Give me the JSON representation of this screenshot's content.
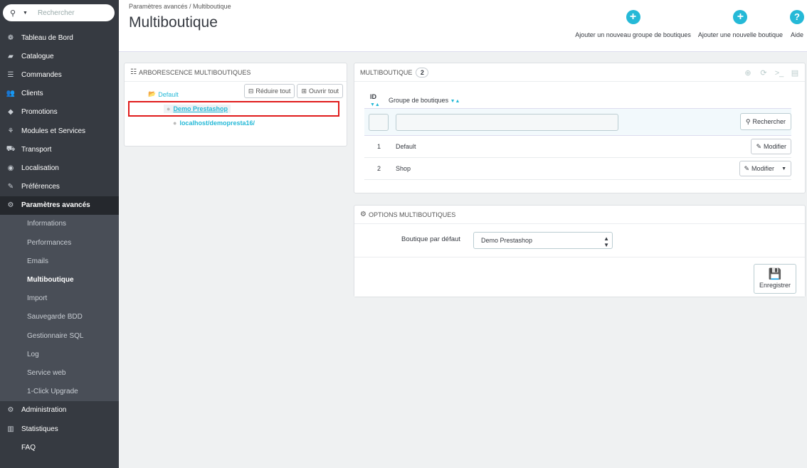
{
  "sidebar": {
    "search_placeholder": "Rechercher",
    "items": [
      {
        "label": "Tableau de Bord",
        "icon": "dashboard-icon",
        "glyph": "❁"
      },
      {
        "label": "Catalogue",
        "icon": "catalog-icon",
        "glyph": "▰"
      },
      {
        "label": "Commandes",
        "icon": "orders-icon",
        "glyph": "☰"
      },
      {
        "label": "Clients",
        "icon": "customers-icon",
        "glyph": "👥"
      },
      {
        "label": "Promotions",
        "icon": "promotions-icon",
        "glyph": "◆"
      },
      {
        "label": "Modules et Services",
        "icon": "modules-icon",
        "glyph": "⚘"
      },
      {
        "label": "Transport",
        "icon": "transport-icon",
        "glyph": "⛟"
      },
      {
        "label": "Localisation",
        "icon": "localisation-icon",
        "glyph": "◉"
      },
      {
        "label": "Préférences",
        "icon": "preferences-icon",
        "glyph": "✎"
      },
      {
        "label": "Paramètres avancés",
        "icon": "advanced-settings-icon",
        "glyph": "⚙"
      }
    ],
    "subitems": [
      "Informations",
      "Performances",
      "Emails",
      "Multiboutique",
      "Import",
      "Sauvegarde BDD",
      "Gestionnaire SQL",
      "Log",
      "Service web",
      "1-Click Upgrade"
    ],
    "bottom_items": [
      {
        "label": "Administration",
        "icon": "administration-icon",
        "glyph": "⚙"
      },
      {
        "label": "Statistiques",
        "icon": "statistics-icon",
        "glyph": "▥"
      },
      {
        "label": "FAQ",
        "icon": "",
        "glyph": ""
      }
    ]
  },
  "header": {
    "breadcrumb": "Paramètres avancés  /  Multiboutique",
    "title": "Multiboutique",
    "toolbar": {
      "add_group": "Ajouter un nouveau groupe de boutiques",
      "add_shop": "Ajouter une nouvelle boutique",
      "help": "Aide"
    }
  },
  "tree": {
    "heading": "Arborescence multiboutiques",
    "collapse_label": "Réduire tout",
    "expand_label": "Ouvrir tout",
    "root": "Default",
    "shop": "Demo Prestashop",
    "url": "localhost/demopresta16/"
  },
  "multishop": {
    "heading": "Multiboutique",
    "count": "2",
    "col_id": "ID",
    "col_group": "Groupe de boutiques",
    "search_label": "Rechercher",
    "rows": [
      {
        "id": "1",
        "name": "Default",
        "action": "Modifier"
      },
      {
        "id": "2",
        "name": "Shop",
        "action": "Modifier"
      }
    ]
  },
  "options": {
    "heading": "Options multiboutiques",
    "default_shop_label": "Boutique par défaut",
    "default_shop_value": "Demo Prestashop",
    "save_label": "Enregistrer"
  },
  "colors": {
    "accent": "#25b9d7",
    "sidebar_bg": "#363a41",
    "highlight": "#e01b1b"
  }
}
